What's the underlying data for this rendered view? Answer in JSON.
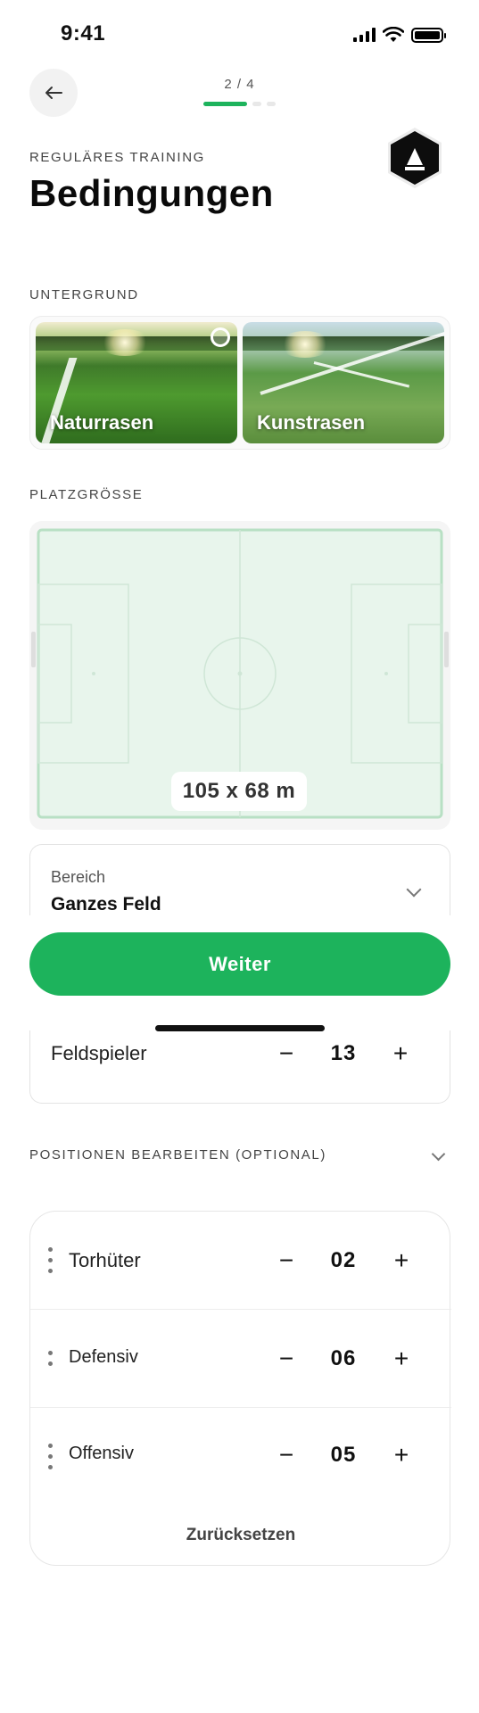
{
  "status_bar": {
    "time": "9:41"
  },
  "header": {
    "step": "2 / 4",
    "kicker": "REGULÄRES TRAINING",
    "title": "Bedingungen"
  },
  "surface": {
    "label": "UNTERGRUND",
    "options": [
      {
        "label": "Naturrasen",
        "selected": true
      },
      {
        "label": "Kunstrasen",
        "selected": false
      }
    ]
  },
  "pitch": {
    "label": "PLATZGRÖSSE",
    "size": "105 x 68 m",
    "field_color": "#e8f5ec",
    "line_color": "#b8e0c4"
  },
  "area": {
    "caption": "Bereich",
    "value": "Ganzes Feld"
  },
  "continue_label": "Weiter",
  "players": {
    "label": "Feldspieler",
    "value": "13",
    "minus": "−",
    "plus": "+"
  },
  "positions": {
    "label": "POSITIONEN BEARBEITEN (OPTIONAL)",
    "rows": [
      {
        "label": "Torhüter",
        "value": "02"
      },
      {
        "label": "Defensiv",
        "value": "06"
      },
      {
        "label": "Offensiv",
        "value": "05"
      }
    ],
    "reset_label": "Zurücksetzen"
  },
  "colors": {
    "accent": "#1db35c",
    "text": "#111111",
    "muted": "#444444"
  },
  "icons": {
    "back": "arrow-left-icon",
    "logo": "hexagon-cone-logo",
    "chevron": "chevron-down-icon"
  }
}
